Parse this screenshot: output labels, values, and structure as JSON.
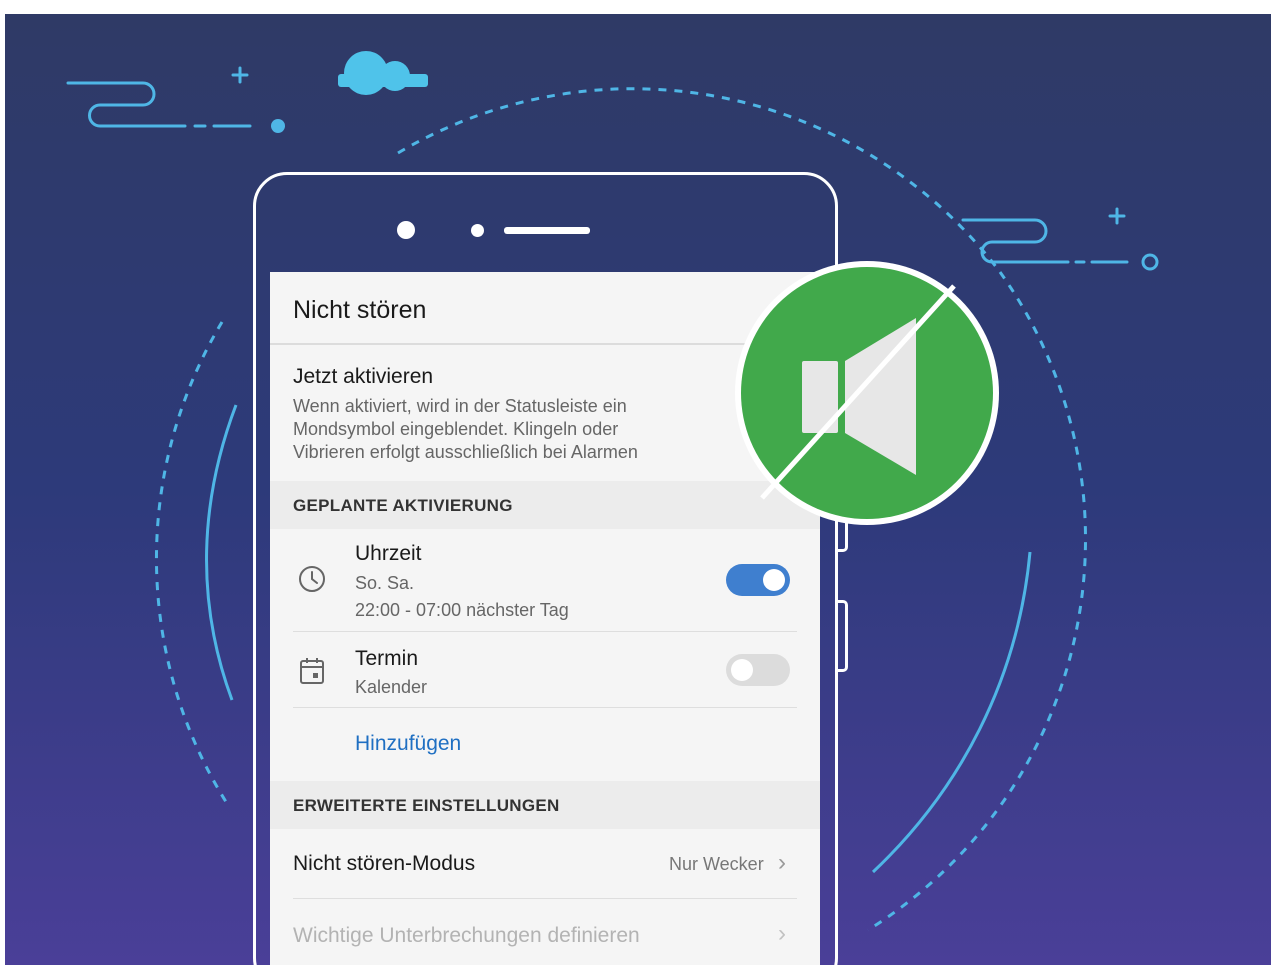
{
  "screen": {
    "title": "Nicht stören",
    "activate": {
      "label": "Jetzt aktivieren",
      "description_lines": [
        "Wenn aktiviert, wird in der Statusleiste ein",
        "Mondsymbol eingeblendet. Klingeln oder",
        "Vibrieren erfolgt ausschließlich bei Alarmen"
      ]
    },
    "scheduled_section": "GEPLANTE AKTIVIERUNG",
    "uhrzeit": {
      "icon": "clock-icon",
      "label": "Uhrzeit",
      "days": "So. Sa.",
      "time": "22:00 - 07:00 nächster Tag",
      "enabled": true
    },
    "termin": {
      "icon": "calendar-icon",
      "label": "Termin",
      "sub": "Kalender",
      "enabled": false
    },
    "add_label": "Hinzufügen",
    "advanced_section": "ERWEITERTE EINSTELLUNGEN",
    "mode": {
      "label": "Nicht stören-Modus",
      "value": "Nur Wecker"
    },
    "interruptions": {
      "label": "Wichtige Unterbrechungen definieren",
      "disabled": true
    }
  },
  "badge": {
    "icon": "speaker-muted-icon",
    "color": "#41a94b"
  },
  "colors": {
    "background_top": "#2f3a66",
    "background_bottom": "#4a3f98",
    "accent": "#3f7fcf",
    "link": "#1f6fc2",
    "decor": "#4fb6e6"
  }
}
